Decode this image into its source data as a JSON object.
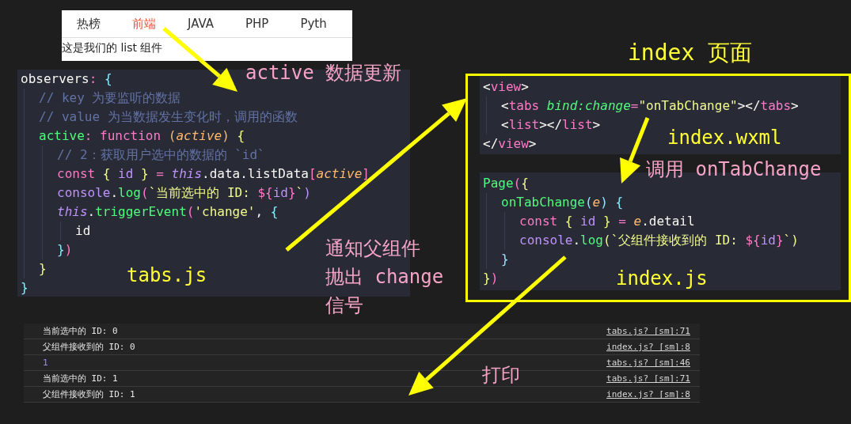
{
  "preview": {
    "tabs": [
      {
        "label": "热榜",
        "selected": false
      },
      {
        "label": "前端",
        "selected": true
      },
      {
        "label": "JAVA",
        "selected": false
      },
      {
        "label": "PHP",
        "selected": false
      },
      {
        "label": "Pyth",
        "selected": false
      }
    ],
    "list_text": "这是我们的 list 组件"
  },
  "tabs_code": {
    "label": "tabs.js",
    "lines": [
      {
        "tokens": [
          {
            "text": "observers",
            "kind": "plain"
          },
          {
            "text": ": ",
            "kind": "pink"
          },
          {
            "text": "{",
            "kind": "blue"
          }
        ],
        "children": [
          {
            "tokens": [
              {
                "text": "// key 为要监听的数据",
                "kind": "comment"
              }
            ]
          },
          {
            "tokens": [
              {
                "text": "// value 为当数据发生变化时，调用的函数",
                "kind": "comment"
              }
            ]
          },
          {
            "tokens": [
              {
                "text": "active",
                "kind": "green"
              },
              {
                "text": ": ",
                "kind": "pink"
              },
              {
                "text": "function ",
                "kind": "pink"
              },
              {
                "text": "(",
                "kind": "orange"
              },
              {
                "text": "active",
                "kind": "param"
              },
              {
                "text": ") ",
                "kind": "orange"
              },
              {
                "text": "{",
                "kind": "yellow"
              }
            ],
            "children": [
              {
                "tokens": [
                  {
                    "text": "// 2：获取用户选中的数据的 `id`",
                    "kind": "comment"
                  }
                ]
              },
              {
                "tokens": [
                  {
                    "text": "const ",
                    "kind": "pink"
                  },
                  {
                    "text": "{ ",
                    "kind": "yellow"
                  },
                  {
                    "text": "id ",
                    "kind": "purple"
                  },
                  {
                    "text": "} ",
                    "kind": "yellow"
                  },
                  {
                    "text": "= ",
                    "kind": "pink"
                  },
                  {
                    "text": "this",
                    "kind": "this"
                  },
                  {
                    "text": ".data.listData",
                    "kind": "plain"
                  },
                  {
                    "text": "[",
                    "kind": "pink"
                  },
                  {
                    "text": "active",
                    "kind": "param"
                  },
                  {
                    "text": "]",
                    "kind": "pink"
                  }
                ]
              },
              {
                "tokens": [
                  {
                    "text": "console",
                    "kind": "purple"
                  },
                  {
                    "text": ".",
                    "kind": "plain"
                  },
                  {
                    "text": "log",
                    "kind": "green"
                  },
                  {
                    "text": "(",
                    "kind": "pink"
                  },
                  {
                    "text": "`当前选中的 ID: ",
                    "kind": "string"
                  },
                  {
                    "text": "${",
                    "kind": "pink"
                  },
                  {
                    "text": "id",
                    "kind": "purple"
                  },
                  {
                    "text": "}",
                    "kind": "pink"
                  },
                  {
                    "text": "`",
                    "kind": "string"
                  },
                  {
                    "text": ")",
                    "kind": "purple"
                  }
                ]
              },
              {
                "tokens": [
                  {
                    "text": "this",
                    "kind": "this"
                  },
                  {
                    "text": ".",
                    "kind": "plain"
                  },
                  {
                    "text": "triggerEvent",
                    "kind": "green"
                  },
                  {
                    "text": "(",
                    "kind": "pink"
                  },
                  {
                    "text": "'change'",
                    "kind": "string"
                  },
                  {
                    "text": ", ",
                    "kind": "plain"
                  },
                  {
                    "text": "{",
                    "kind": "blue"
                  }
                ],
                "children": [
                  {
                    "tokens": [
                      {
                        "text": "id",
                        "kind": "plain"
                      }
                    ]
                  }
                ]
              },
              {
                "tokens": [
                  {
                    "text": "}",
                    "kind": "blue"
                  },
                  {
                    "text": ")",
                    "kind": "pink"
                  }
                ]
              }
            ]
          },
          {
            "tokens": [
              {
                "text": "}",
                "kind": "yellow"
              }
            ]
          }
        ]
      },
      {
        "tokens": [
          {
            "text": "}",
            "kind": "blue"
          }
        ]
      }
    ]
  },
  "wxml_code": {
    "label": "index.wxml",
    "lines": [
      {
        "tokens": [
          {
            "text": "<",
            "kind": "plain"
          },
          {
            "text": "view",
            "kind": "pink"
          },
          {
            "text": ">",
            "kind": "plain"
          }
        ],
        "children": [
          {
            "tokens": [
              {
                "text": "<",
                "kind": "plain"
              },
              {
                "text": "tabs ",
                "kind": "pink"
              },
              {
                "text": "bind:change",
                "kind": "attr"
              },
              {
                "text": "=",
                "kind": "pink"
              },
              {
                "text": "\"onTabChange\"",
                "kind": "string"
              },
              {
                "text": "></",
                "kind": "plain"
              },
              {
                "text": "tabs",
                "kind": "pink"
              },
              {
                "text": ">",
                "kind": "plain"
              }
            ]
          },
          {
            "tokens": [
              {
                "text": "<",
                "kind": "plain"
              },
              {
                "text": "list",
                "kind": "pink"
              },
              {
                "text": "></",
                "kind": "plain"
              },
              {
                "text": "list",
                "kind": "pink"
              },
              {
                "text": ">",
                "kind": "plain"
              }
            ]
          }
        ]
      },
      {
        "tokens": [
          {
            "text": "</",
            "kind": "plain"
          },
          {
            "text": "view",
            "kind": "pink"
          },
          {
            "text": ">",
            "kind": "plain"
          }
        ]
      }
    ]
  },
  "index_code": {
    "label": "index.js",
    "lines": [
      {
        "tokens": [
          {
            "text": "Page",
            "kind": "green"
          },
          {
            "text": "(",
            "kind": "pink"
          },
          {
            "text": "{",
            "kind": "yellow"
          }
        ],
        "children": [
          {
            "tokens": [
              {
                "text": "onTabChange",
                "kind": "green"
              },
              {
                "text": "(",
                "kind": "blue"
              },
              {
                "text": "e",
                "kind": "param"
              },
              {
                "text": ") ",
                "kind": "blue"
              },
              {
                "text": "{",
                "kind": "blue"
              }
            ],
            "children": [
              {
                "tokens": [
                  {
                    "text": "const ",
                    "kind": "pink"
                  },
                  {
                    "text": "{ ",
                    "kind": "yellow"
                  },
                  {
                    "text": "id ",
                    "kind": "purple"
                  },
                  {
                    "text": "} ",
                    "kind": "yellow"
                  },
                  {
                    "text": "= ",
                    "kind": "pink"
                  },
                  {
                    "text": "e",
                    "kind": "param"
                  },
                  {
                    "text": ".detail",
                    "kind": "plain"
                  }
                ]
              },
              {
                "tokens": [
                  {
                    "text": "console",
                    "kind": "purple"
                  },
                  {
                    "text": ".",
                    "kind": "plain"
                  },
                  {
                    "text": "log",
                    "kind": "green"
                  },
                  {
                    "text": "(",
                    "kind": "yellow"
                  },
                  {
                    "text": "`父组件接收到的 ID: ",
                    "kind": "string"
                  },
                  {
                    "text": "${",
                    "kind": "pink"
                  },
                  {
                    "text": "id",
                    "kind": "purple"
                  },
                  {
                    "text": "}",
                    "kind": "pink"
                  },
                  {
                    "text": "`",
                    "kind": "string"
                  },
                  {
                    "text": ")",
                    "kind": "yellow"
                  }
                ]
              }
            ]
          },
          {
            "tokens": [
              {
                "text": "}",
                "kind": "blue"
              }
            ]
          }
        ]
      },
      {
        "tokens": [
          {
            "text": "}",
            "kind": "yellow"
          },
          {
            "text": ")",
            "kind": "pink"
          }
        ]
      }
    ]
  },
  "annotations": {
    "active_update": "active 数据更新",
    "call": "调用 onTabChange",
    "frame_title": "index 页面",
    "notify": [
      "通知父组件",
      "抛出 change",
      "信号"
    ],
    "print": "打印"
  },
  "console": [
    {
      "message": "当前选中的 ID: 0",
      "kind": "text",
      "source": "tabs.js? [sm]:71"
    },
    {
      "message": "父组件接收到的 ID: 0",
      "kind": "text",
      "source": "index.js? [sm]:8"
    },
    {
      "message": "1",
      "kind": "number",
      "source": "tabs.js? [sm]:46"
    },
    {
      "message": "当前选中的 ID: 1",
      "kind": "text",
      "source": "tabs.js? [sm]:71"
    },
    {
      "message": "父组件接收到的 ID: 1",
      "kind": "text",
      "source": "index.js? [sm]:8"
    }
  ]
}
